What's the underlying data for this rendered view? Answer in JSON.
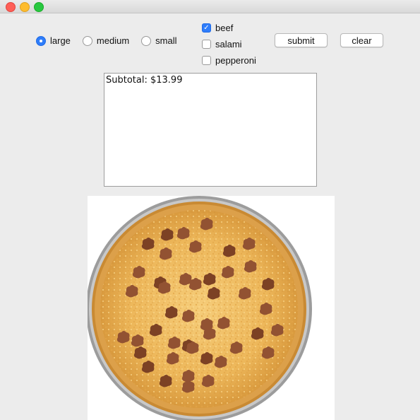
{
  "window": {
    "traffic_lights": [
      "close",
      "minimize",
      "zoom"
    ]
  },
  "size_options": [
    {
      "label": "large",
      "selected": true
    },
    {
      "label": "medium",
      "selected": false
    },
    {
      "label": "small",
      "selected": false
    }
  ],
  "toppings": [
    {
      "label": "beef",
      "checked": true
    },
    {
      "label": "salami",
      "checked": false
    },
    {
      "label": "pepperoni",
      "checked": false
    }
  ],
  "buttons": {
    "submit": "submit",
    "clear": "clear"
  },
  "output": {
    "text": "Subtotal: $13.99"
  },
  "pizza": {
    "size": "large",
    "topping": "beef"
  },
  "colors": {
    "accent": "#2f7dfa",
    "crust": "#c98a33",
    "cheese": "#f2c36a",
    "beef": "#8a4a2a"
  }
}
